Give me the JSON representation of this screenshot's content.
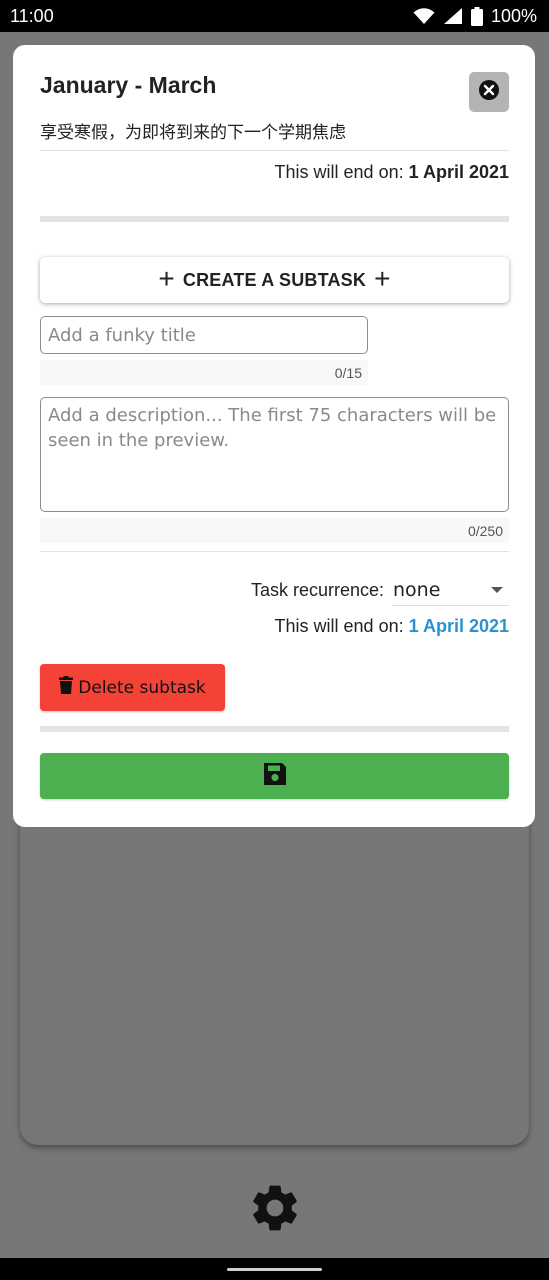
{
  "status_bar": {
    "time": "11:00",
    "battery": "100%",
    "icons": [
      "wifi-icon",
      "signal-icon",
      "battery-icon"
    ]
  },
  "dialog": {
    "title": "January - March",
    "subtitle": "享受寒假，为即将到来的下一个学期焦虑",
    "end_label": "This will end on:",
    "end_date": "1 April 2021",
    "close_icon": "close-icon"
  },
  "subtask": {
    "create_label": "CREATE A SUBTASK",
    "title_placeholder": "Add a funky title",
    "title_value": "",
    "title_counter": "0/15",
    "description_placeholder": "Add a description... The first 75 characters will be seen in the preview.",
    "description_value": "",
    "description_counter": "0/250",
    "recurrence_label": "Task recurrence:",
    "recurrence_value": "none",
    "end_label": "This will end on:",
    "end_date": "1 April 2021",
    "delete_label": "Delete subtask",
    "save_icon": "floppy-disk-icon"
  },
  "bottom": {
    "settings_icon": "gear-icon"
  },
  "colors": {
    "delete": "#f44336",
    "save": "#4caf50",
    "link_blue": "#2a93cf",
    "overlay": "#777777"
  }
}
